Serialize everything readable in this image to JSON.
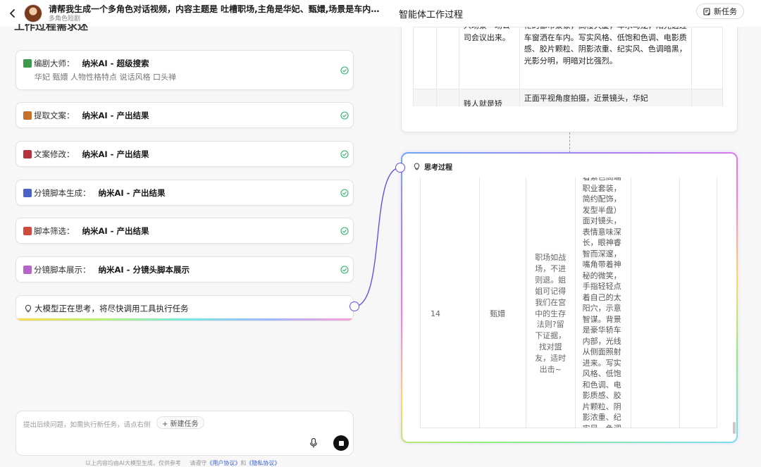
{
  "header": {
    "title": "请帮我生成一个多角色对话视频，内容主题是 吐槽职场,主角是华妃、甄嬛,场景是车内对谈,...",
    "subtitle": "多角色短剧",
    "back_icon": "chevron-left-icon"
  },
  "right_header": {
    "title": "智能体工作过程",
    "new_task_label": "新任务"
  },
  "left": {
    "partial_heading": "工作过程需求述",
    "steps": [
      {
        "name": "编剧大师：",
        "tool": "纳米AI - 超级搜索",
        "sub": "华妃 甄嬛 人物性格特点 说话风格 口头禅",
        "icon_color": "#3c9a4a",
        "done": true
      },
      {
        "name": "提取文案：",
        "tool": "纳米AI - 产出结果",
        "sub": "",
        "icon_color": "#c5712b",
        "done": true
      },
      {
        "name": "文案修改：",
        "tool": "纳米AI - 产出结果",
        "sub": "",
        "icon_color": "#b3343c",
        "done": true
      },
      {
        "name": "分镜脚本生成：",
        "tool": "纳米AI - 产出结果",
        "sub": "",
        "icon_color": "#4b63c8",
        "done": true
      },
      {
        "name": "脚本筛选：",
        "tool": "纳米AI - 产出结果",
        "sub": "",
        "icon_color": "#d14b3c",
        "done": true
      },
      {
        "name": "分镜脚本展示：",
        "tool": "纳米AI - 分镜头脚本展示",
        "sub": "",
        "icon_color": "#b565c8",
        "done": true
      }
    ],
    "thinking_text": "大模型正在思考，将尽快调用工具执行任务"
  },
  "input": {
    "placeholder": "提出后续问题，如需执行新任务，请点右侧",
    "new_task_chip": "+ 新建任务"
  },
  "footer": {
    "prefix": "以上内容均由AI大模型生成，仅供参考",
    "follow": "请遵守",
    "user_agreement": "《用户协议》",
    "and": "和",
    "privacy_policy": "《隐私协议》"
  },
  "top_table": {
    "row1": {
      "col3": "入场景一场公司会议出来。",
      "col4": "忙的都市景象，高楼大厦，车水马龙，阳光透过车窗洒在车内。写实风格、低饱和色调、电影质感、胶片颗粒、阴影浓重、纪实风、色调暗黑，光影分明，明暗对比强烈。"
    },
    "row2": {
      "col3": "贱人就是矫",
      "col4": "正面平视角度拍摄，近景镜头，华妃"
    }
  },
  "thinking_panel": {
    "title": "思考过程",
    "row": {
      "index": "14",
      "character": "甄嬛",
      "dialogue": "职场如战场，不进则退。姐姐可记得我们在宫中的生存法则?留下证据，找对盟友，适时出击~",
      "visual": "着紫色高端职业套装，简约配饰，发型半盘）面对镜头，表情意味深长，眼神睿智而深邃，嘴角带着神秘的微笑，手指轻轻点着自己的太阳穴，示意智谋。背景是豪华轿车内部，光线从侧面照射进来。写实风格、低饱和色调、电影质感、胶片颗粒、阴影浓重、纪实风、色调暗黑，光影分明，明"
    }
  },
  "colors": {
    "accent": "#6a4ee8",
    "check": "#2fb36a"
  }
}
